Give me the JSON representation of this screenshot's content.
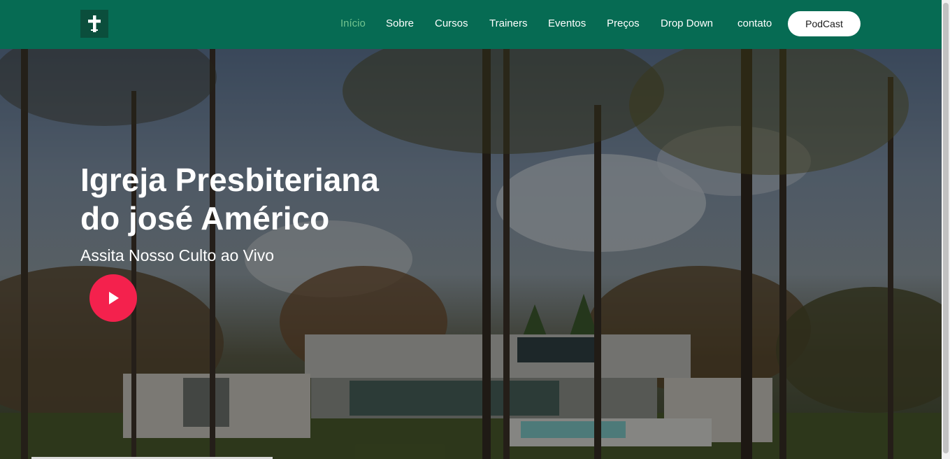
{
  "navbar": {
    "logo_icon": "cross-icon",
    "bg_color": "#066b53",
    "active_color": "#72c48f",
    "items": [
      {
        "label": "Início",
        "active": true
      },
      {
        "label": "Sobre"
      },
      {
        "label": "Cursos"
      },
      {
        "label": "Trainers"
      },
      {
        "label": "Eventos"
      },
      {
        "label": "Preços"
      },
      {
        "label": "Drop Down"
      },
      {
        "label": "contato"
      }
    ],
    "cta_label": "PodCast"
  },
  "hero": {
    "title_line1": "Igreja Presbiteriana",
    "title_line2": "do josé Américo",
    "subtitle": "Assita Nosso Culto ao Vivo",
    "play_icon": "play-icon",
    "play_color": "#f4214d"
  }
}
